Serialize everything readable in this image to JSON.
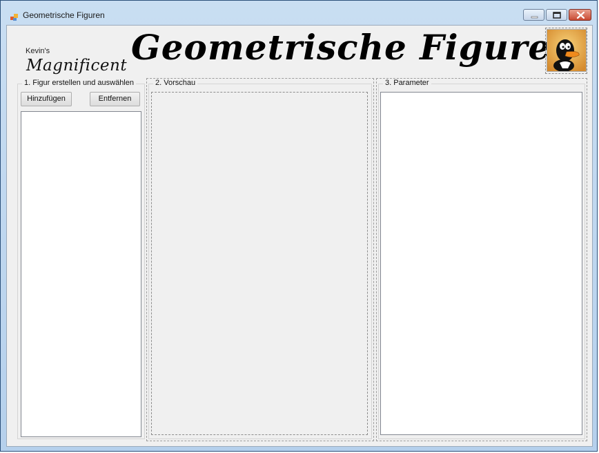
{
  "window": {
    "title": "Geometrische Figuren",
    "icon": "app-icon",
    "controls": [
      "minimize-icon",
      "maximize-icon",
      "close-icon"
    ]
  },
  "header": {
    "byline": "Kevin's",
    "subtitle": "Magnificent",
    "title": "Geometrische Figuren",
    "image": "duck-picture"
  },
  "groups": {
    "figures": {
      "legend": "1. Figur erstellen und auswählen",
      "add_label": "Hinzufügen",
      "remove_label": "Entfernen"
    },
    "preview": {
      "legend": "2. Vorschau"
    },
    "parameters": {
      "legend": "3. Parameter"
    }
  },
  "colors": {
    "titlebar": "#b5d0ec",
    "client_bg": "#f0f0f0",
    "close_button": "#c94a33"
  }
}
